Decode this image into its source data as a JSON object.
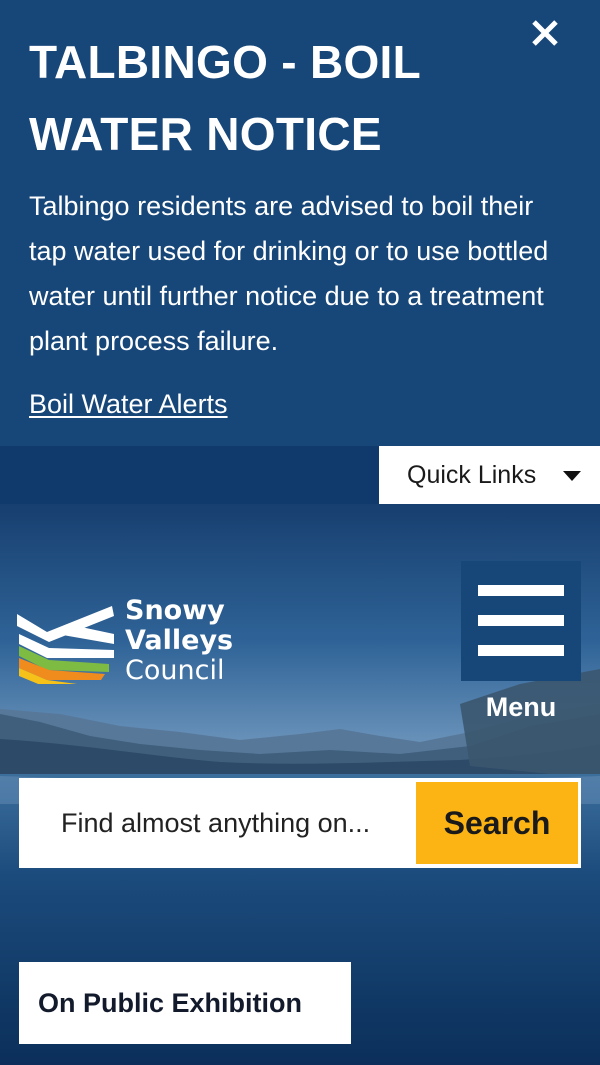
{
  "alert": {
    "title": "TALBINGO - BOIL WATER NOTICE",
    "body": "Talbingo residents are advised to boil their tap water used for drinking or to use bottled water until further notice due to a treatment plant process failure.",
    "link": "Boil Water Alerts",
    "close_icon": "close-icon"
  },
  "quick_links": {
    "label": "Quick Links",
    "icon": "caret-down-icon"
  },
  "logo": {
    "line1": "Snowy",
    "line2": "Valleys",
    "line3": "Council"
  },
  "menu": {
    "label": "Menu",
    "icon": "hamburger-icon"
  },
  "search": {
    "placeholder": "Find almost anything on...",
    "button_label": "Search"
  },
  "exhibition": {
    "label": "On Public Exhibition"
  },
  "colors": {
    "alert_bg": "#174678",
    "accent_yellow": "#fbb414",
    "logo_white": "#ffffff",
    "logo_green": "#7dbb42",
    "logo_orange": "#f08b1d",
    "logo_yellow": "#f6c21a"
  }
}
